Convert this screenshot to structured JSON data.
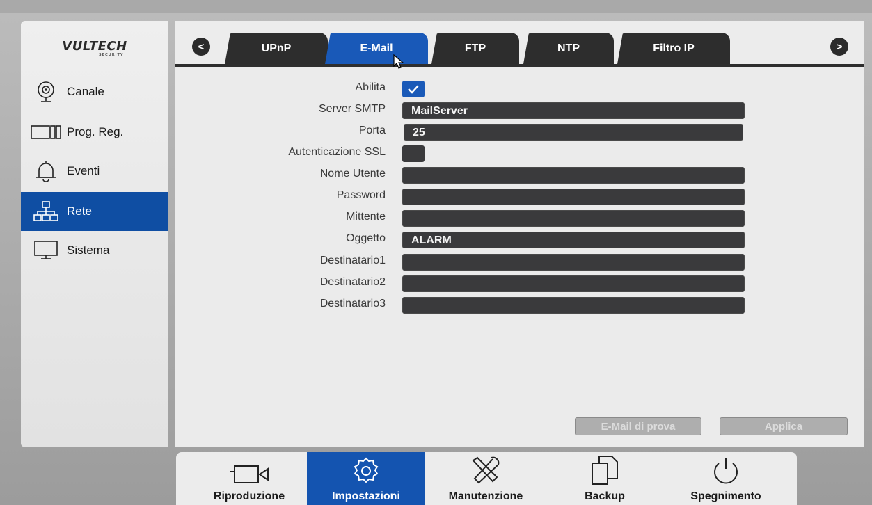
{
  "app": {
    "logo": "VULTECH",
    "logo_sub": "SECURITY"
  },
  "sidebar": {
    "items": [
      {
        "label": "Canale",
        "icon": "camera-icon"
      },
      {
        "label": "Prog. Reg.",
        "icon": "recording-schedule-icon"
      },
      {
        "label": "Eventi",
        "icon": "bell-icon"
      },
      {
        "label": "Rete",
        "icon": "network-icon",
        "active": true
      },
      {
        "label": "Sistema",
        "icon": "monitor-icon"
      }
    ]
  },
  "tabs": {
    "prev": "<",
    "next": ">",
    "items": [
      {
        "label": "UPnP"
      },
      {
        "label": "E-Mail",
        "active": true
      },
      {
        "label": "FTP"
      },
      {
        "label": "NTP"
      },
      {
        "label": "Filtro IP"
      }
    ]
  },
  "form": {
    "abilita": {
      "label": "Abilita",
      "checked": true
    },
    "server_smtp": {
      "label": "Server SMTP",
      "value": "MailServer"
    },
    "porta": {
      "label": "Porta",
      "value": "25"
    },
    "ssl": {
      "label": "Autenticazione SSL",
      "checked": false
    },
    "nome_utente": {
      "label": "Nome Utente",
      "value": ""
    },
    "password": {
      "label": "Password",
      "value": ""
    },
    "mittente": {
      "label": "Mittente",
      "value": ""
    },
    "oggetto": {
      "label": "Oggetto",
      "value": "ALARM"
    },
    "destinatario1": {
      "label": "Destinatario1",
      "value": ""
    },
    "destinatario2": {
      "label": "Destinatario2",
      "value": ""
    },
    "destinatario3": {
      "label": "Destinatario3",
      "value": ""
    }
  },
  "actions": {
    "test_email": "E-Mail di prova",
    "apply": "Applica"
  },
  "dock": {
    "items": [
      {
        "label": "Riproduzione",
        "icon": "video-camera-icon"
      },
      {
        "label": "Impostazioni",
        "icon": "settings-gear-icon",
        "active": true
      },
      {
        "label": "Manutenzione",
        "icon": "tools-icon"
      },
      {
        "label": "Backup",
        "icon": "backup-files-icon"
      },
      {
        "label": "Spegnimento",
        "icon": "power-icon"
      }
    ]
  },
  "colors": {
    "accent": "#1959b8",
    "field": "#3a3a3c",
    "panel": "#ebebeb"
  }
}
